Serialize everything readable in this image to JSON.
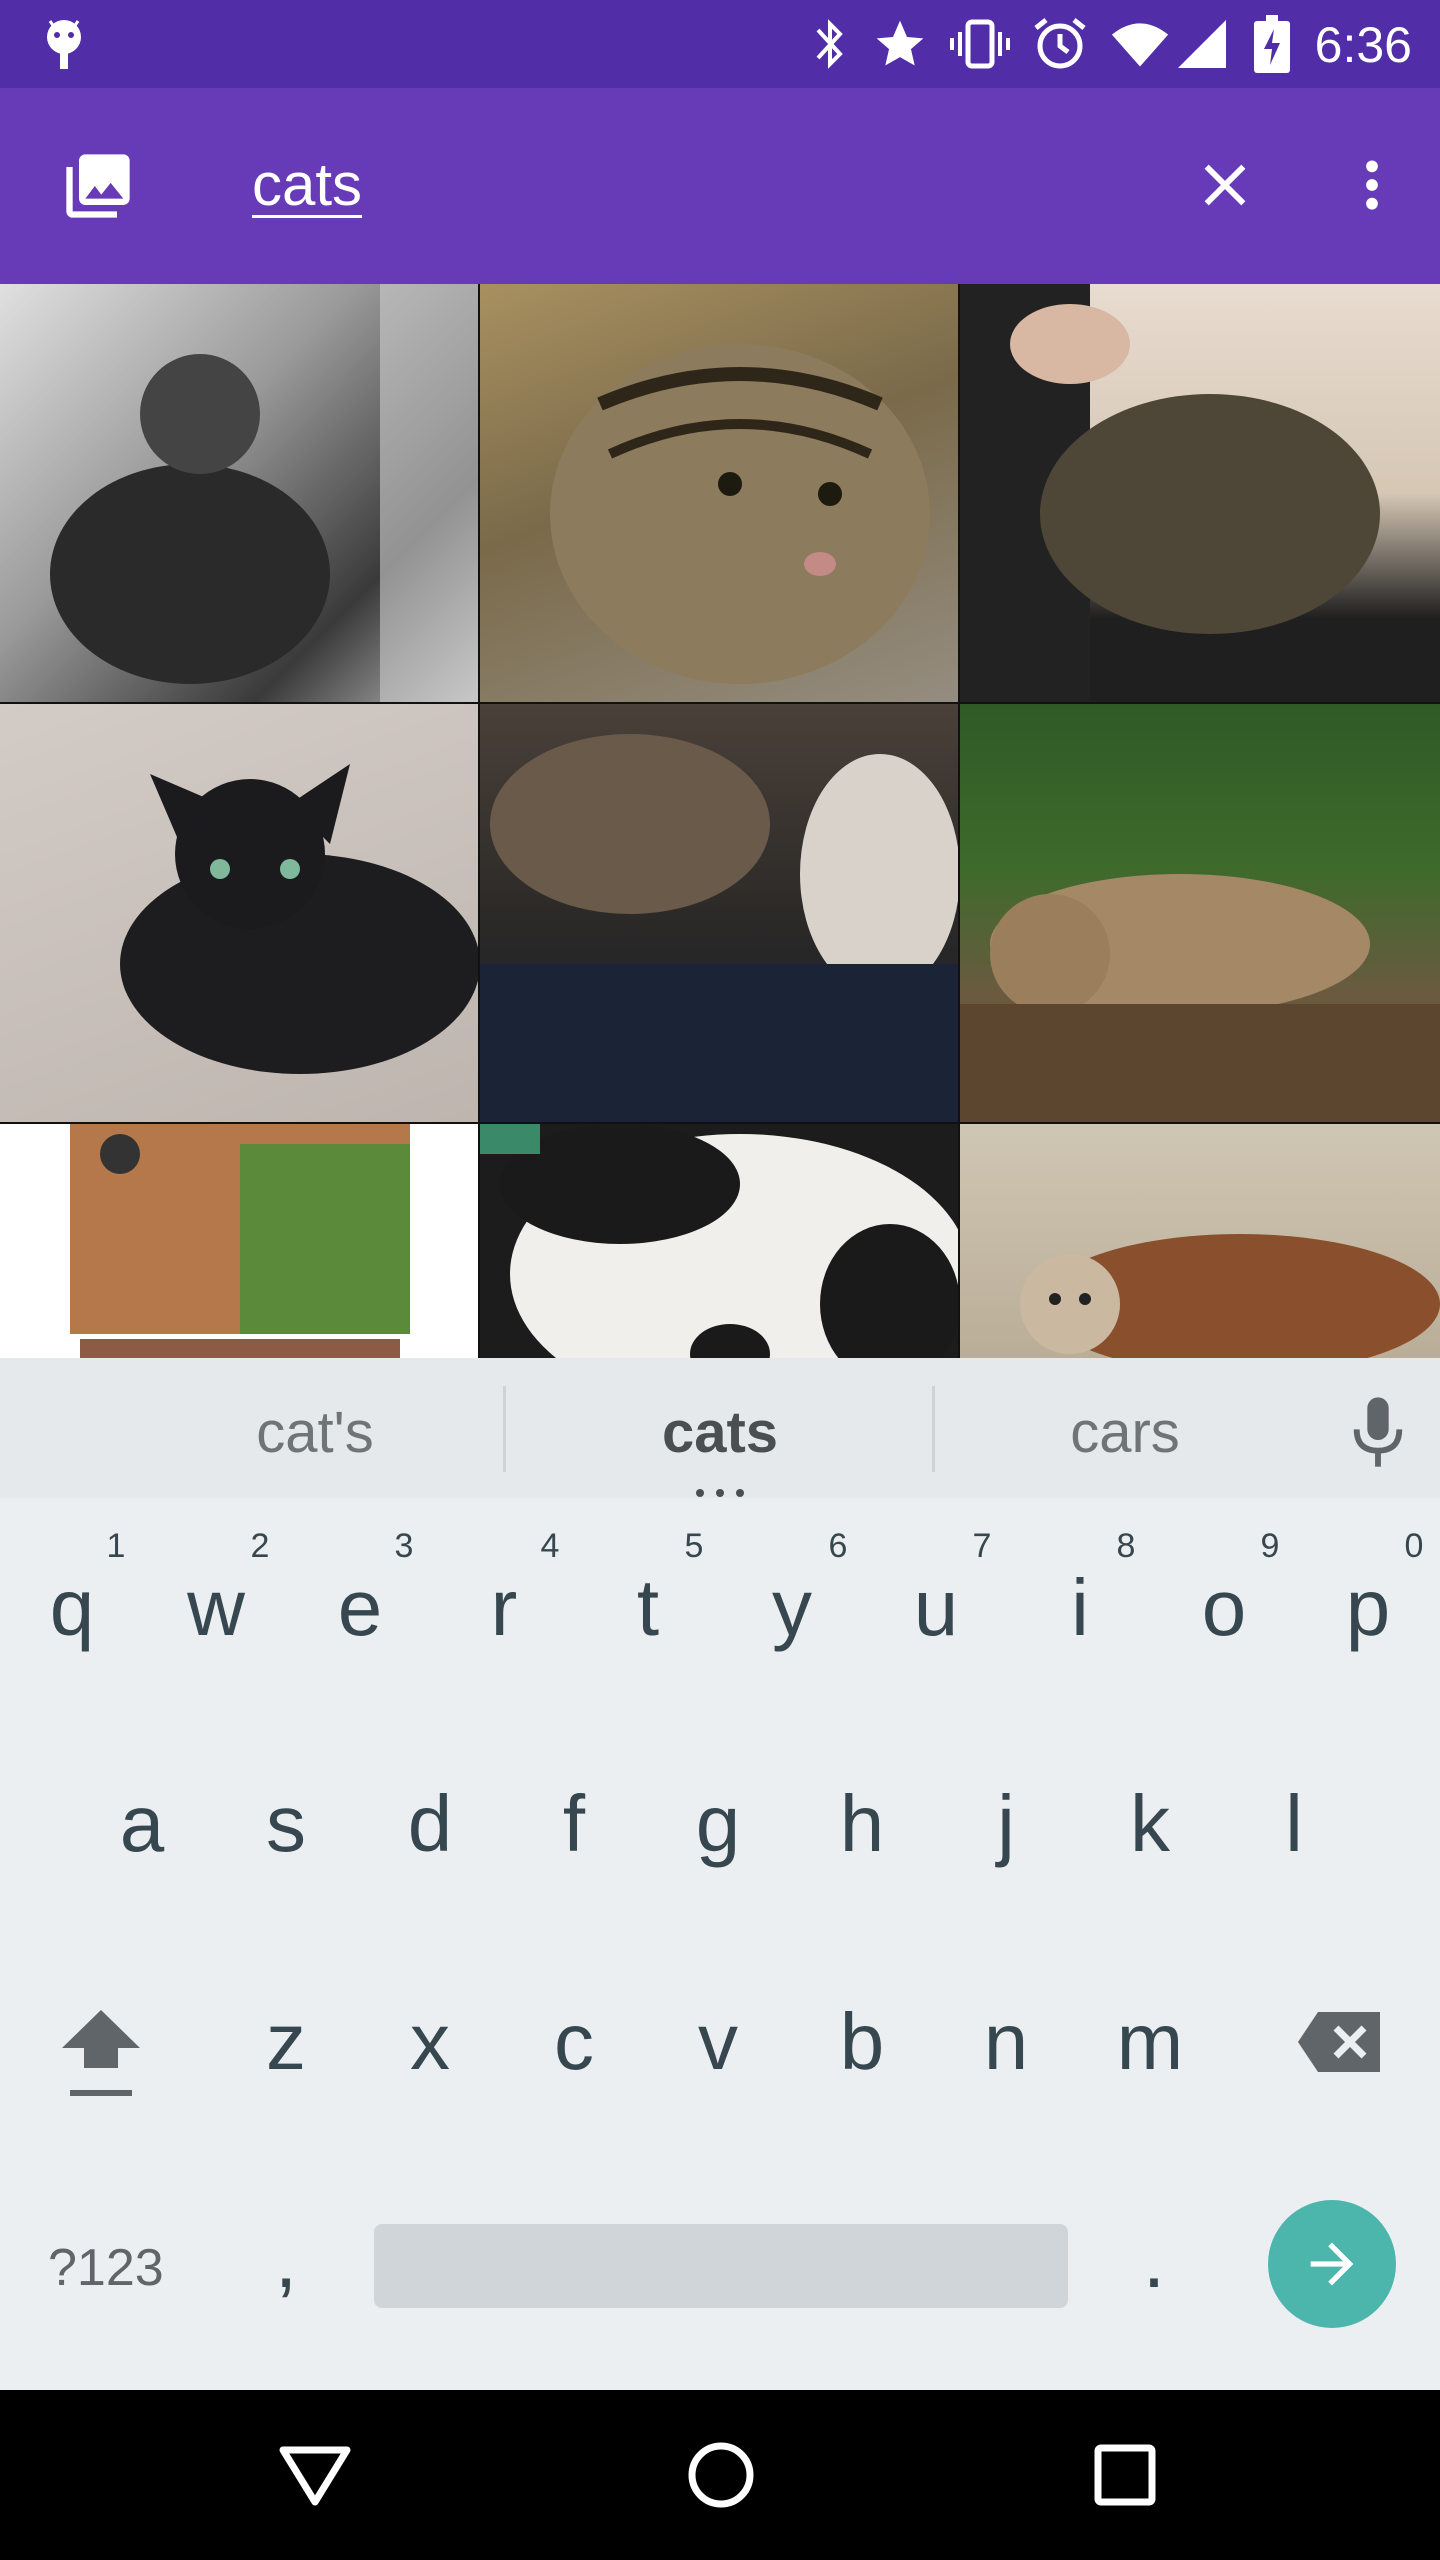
{
  "status_bar": {
    "time": "6:36",
    "icons": [
      "android-icon",
      "bluetooth-icon",
      "star-icon",
      "vibrate-icon",
      "alarm-icon",
      "wifi-icon",
      "signal-icon",
      "battery-charging-icon"
    ]
  },
  "app_bar": {
    "search_query": "cats",
    "icons": [
      "gallery-icon",
      "clear-icon",
      "overflow-menu-icon"
    ],
    "color": "#673ab7",
    "status_color": "#512da8"
  },
  "image_grid": {
    "tiles": [
      "cat photo 1",
      "cat photo 2",
      "cat photo 3",
      "cat photo 4",
      "cat photo 5",
      "cat photo 6",
      "cat photo 7",
      "cat photo 8",
      "cat photo 9"
    ]
  },
  "keyboard": {
    "suggestions": [
      "cat's",
      "cats",
      "cars"
    ],
    "row1": [
      "q",
      "w",
      "e",
      "r",
      "t",
      "y",
      "u",
      "i",
      "o",
      "p"
    ],
    "row1_hints": [
      "1",
      "2",
      "3",
      "4",
      "5",
      "6",
      "7",
      "8",
      "9",
      "0"
    ],
    "row2": [
      "a",
      "s",
      "d",
      "f",
      "g",
      "h",
      "j",
      "k",
      "l"
    ],
    "row3": [
      "z",
      "x",
      "c",
      "v",
      "b",
      "n",
      "m"
    ],
    "symbols_label": "?123",
    "comma": ",",
    "period": ".",
    "enter_color": "#4db6ac"
  },
  "nav_bar": {
    "icons": [
      "back-icon",
      "home-icon",
      "recents-icon"
    ]
  }
}
